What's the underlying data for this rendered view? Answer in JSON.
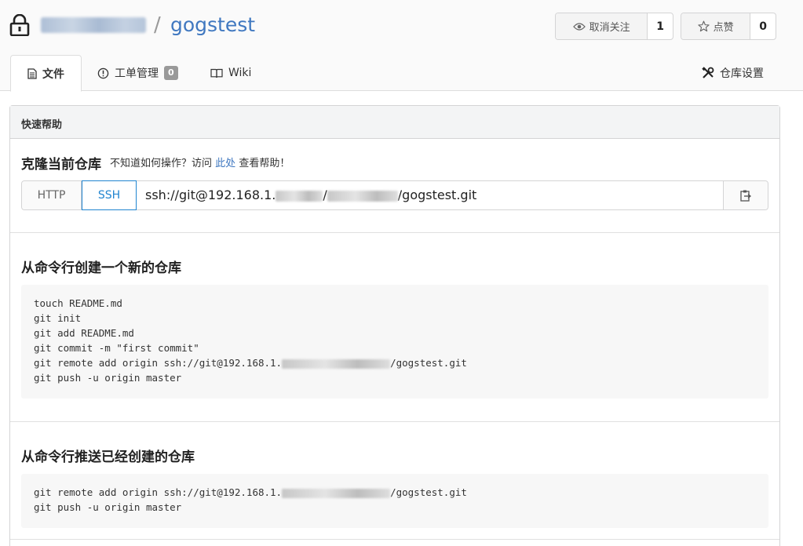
{
  "repo": {
    "separator": "/",
    "name": "gogstest"
  },
  "actions": {
    "watch": {
      "label": "取消关注",
      "count": "1"
    },
    "star": {
      "label": "点赞",
      "count": "0"
    }
  },
  "tabs": [
    {
      "label": "文件"
    },
    {
      "label": "工单管理",
      "badge": "0"
    },
    {
      "label": "Wiki"
    },
    {
      "label": "仓库设置"
    }
  ],
  "quick_help": {
    "title": "快速帮助",
    "clone": {
      "title": "克隆当前仓库",
      "hint_before": "不知道如何操作？访问",
      "hint_link": "此处",
      "hint_after": "查看帮助！",
      "protocols": [
        "HTTP",
        "SSH"
      ],
      "selected_protocol": "SSH",
      "url_start": "ssh://git@192.168.1.",
      "url_sep": "/",
      "url_end": "/gogstest.git"
    },
    "new_repo": {
      "title": "从命令行创建一个新的仓库",
      "lines": [
        "touch README.md",
        "git init",
        "git add README.md",
        "git commit -m \"first commit\"",
        "git remote add origin ssh://git@192.168.1.",
        "git push -u origin master"
      ],
      "remote_suffix": "/gogstest.git"
    },
    "push_existing": {
      "title": "从命令行推送已经创建的仓库",
      "lines": [
        "git remote add origin ssh://git@192.168.1.",
        "git push -u origin master"
      ],
      "remote_suffix": "/gogstest.git"
    }
  },
  "colors": {
    "link": "#4078c0",
    "selected_protocol": "#2185d0"
  }
}
